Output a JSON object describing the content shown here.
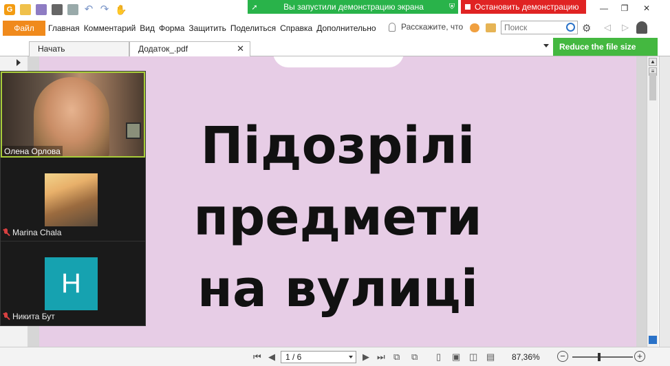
{
  "title_bar": {
    "app_logo": "G",
    "icons": [
      "open-icon",
      "save-icon",
      "print-icon",
      "mail-icon",
      "undo-icon",
      "redo-icon",
      "hand-tool-icon"
    ]
  },
  "screen_share": {
    "status_text": "Вы запустили демонстрацию экрана",
    "stop_label": "Остановить демонстрацию"
  },
  "menu": {
    "file": "Файл",
    "items": [
      "Главная",
      "Комментарий",
      "Вид",
      "Форма",
      "Защитить",
      "Поделиться",
      "Справка",
      "Дополнительно"
    ],
    "tell_me": "Расскажите, что",
    "search_placeholder": "Поиск"
  },
  "tabs": {
    "start": "Начать",
    "document": "Додаток_.pdf"
  },
  "reduce_button": "Reduce the file size",
  "document": {
    "headline_lines": [
      "Підозрілі",
      "предмети",
      "на вулиці"
    ]
  },
  "statusbar": {
    "page_indicator": "1 / 6",
    "zoom": "87,36%",
    "zoom_level": 0.42
  },
  "call": {
    "participants": [
      {
        "name": "Олена Орлова",
        "muted": false,
        "active": true
      },
      {
        "name": "Marina Chala",
        "muted": true
      },
      {
        "name": "Никита Бут",
        "muted": true,
        "initial": "H"
      }
    ]
  },
  "colors": {
    "accent_orange": "#f08a1c",
    "share_green": "#29b34a",
    "share_red": "#e02323",
    "reduce_green": "#44b840",
    "page_background": "#e7cde6",
    "avatar_teal": "#16a2b0"
  }
}
